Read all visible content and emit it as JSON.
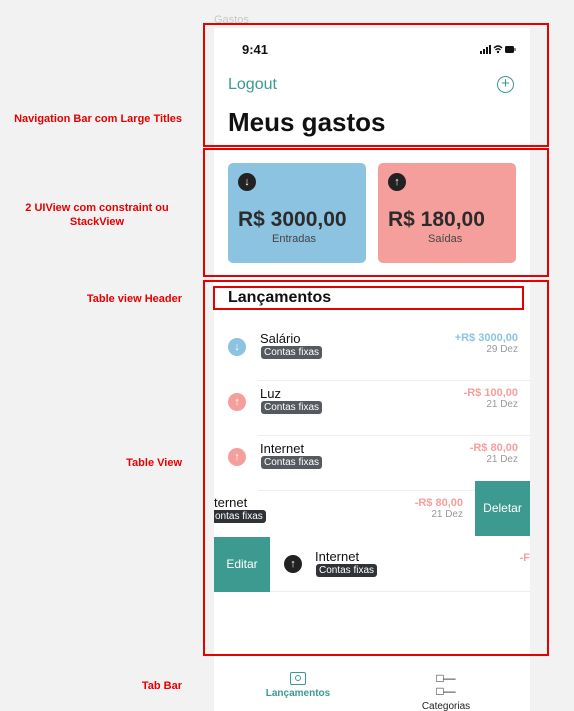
{
  "frame_label": "Gastos",
  "annotations": {
    "nav_bar": "Navigation Bar com Large Titles",
    "stack_view": "2 UIView com constraint ou StackView",
    "table_header": "Table view Header",
    "table_view": "Table View",
    "tab_bar": "Tab Bar"
  },
  "status_bar": {
    "time": "9:41",
    "icons": "signal wifi battery"
  },
  "nav": {
    "logout": "Logout",
    "title": "Meus gastos"
  },
  "cards": {
    "income": {
      "value": "R$ 3000,00",
      "label": "Entradas"
    },
    "expense": {
      "value": "R$ 180,00",
      "label": "Saídas"
    }
  },
  "section_header": "Lançamentos",
  "rows": [
    {
      "name": "Salário",
      "tag": "Contas fixas",
      "amount": "+R$ 3000,00",
      "date": "29 Dez"
    },
    {
      "name": "Luz",
      "tag": "Contas fixas",
      "amount": "-R$ 100,00",
      "date": "21 Dez"
    },
    {
      "name": "Internet",
      "tag": "Contas fixas",
      "amount": "-R$ 80,00",
      "date": "21 Dez"
    },
    {
      "name": "ternet",
      "tag": "ontas fixas",
      "amount": "-R$ 80,00",
      "date": "21 Dez"
    },
    {
      "name": "Internet",
      "tag": "Contas fixas",
      "amount": "-F"
    }
  ],
  "actions": {
    "delete": "Deletar",
    "edit": "Editar"
  },
  "tabs": {
    "lancamentos": "Lançamentos",
    "categorias": "Categorias"
  },
  "colors": {
    "accent": "#3a9a91",
    "income": "#8cc3e0",
    "expense": "#f59f9d",
    "annotation": "#e60000"
  }
}
